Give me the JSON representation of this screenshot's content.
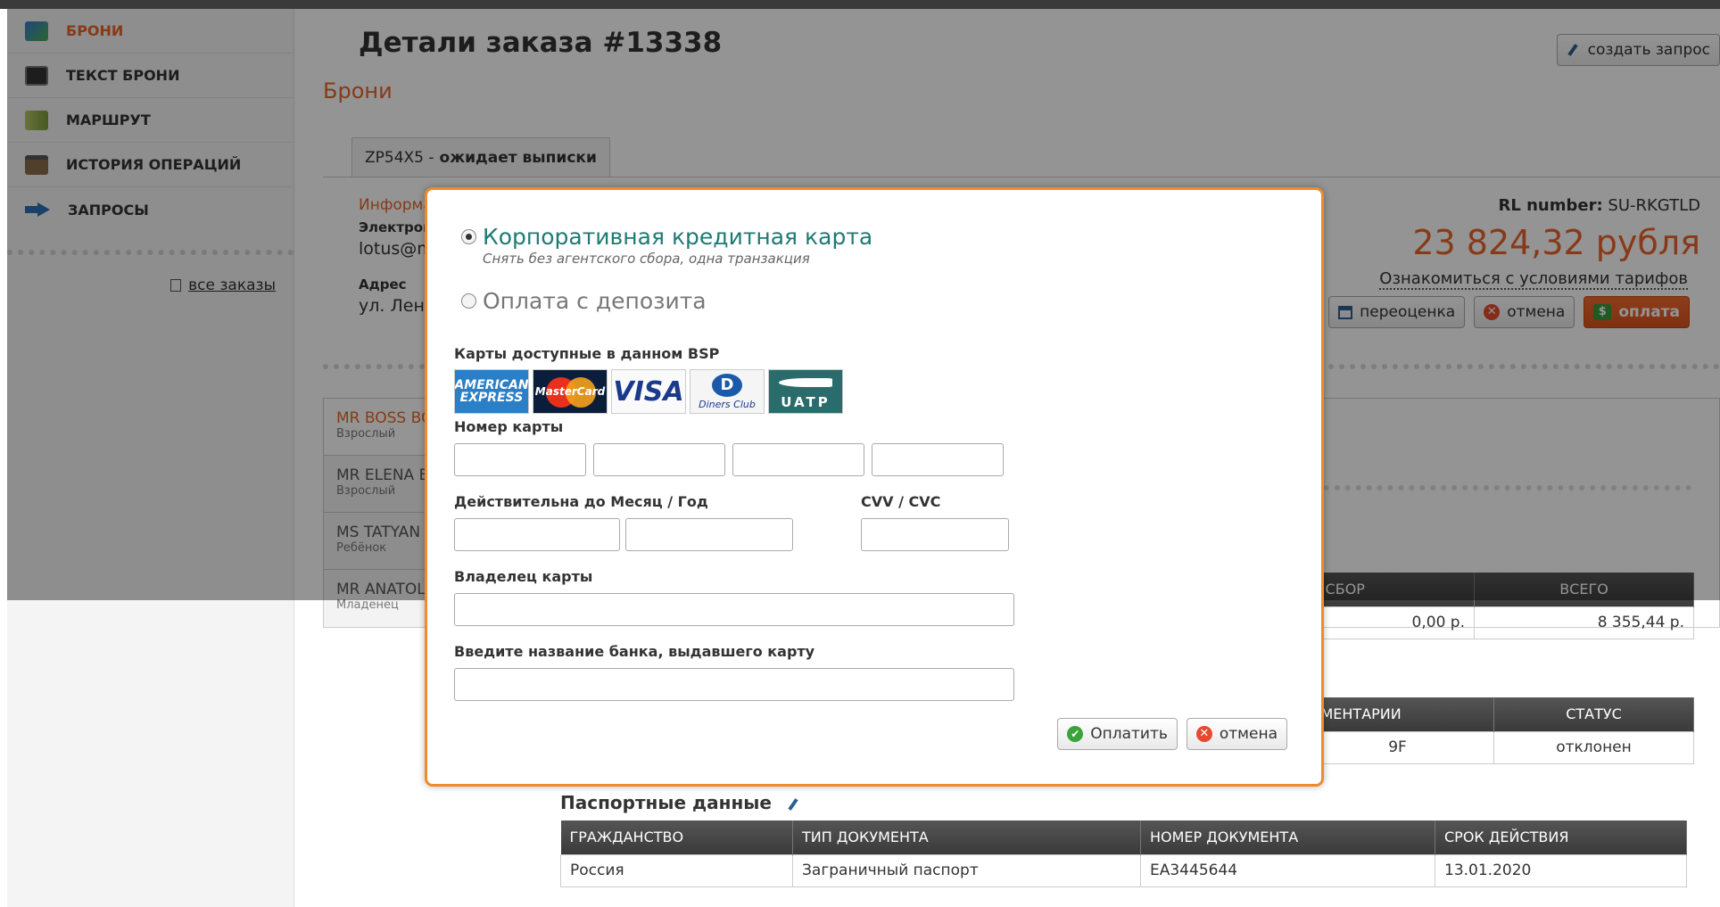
{
  "sidebar": {
    "items": [
      {
        "label": "БРОНИ",
        "icon": "bookings-icon"
      },
      {
        "label": "ТЕКСТ БРОНИ",
        "icon": "terminal-icon"
      },
      {
        "label": "МАРШРУТ",
        "icon": "map-icon"
      },
      {
        "label": "ИСТОРИЯ ОПЕРАЦИЙ",
        "icon": "history-icon"
      },
      {
        "label": "ЗАПРОСЫ",
        "icon": "arrow-right-icon"
      }
    ],
    "all_orders": "все заказы"
  },
  "header": {
    "title": "Детали заказа #13338",
    "create_request": "создать запрос"
  },
  "section_title": "Брони",
  "booking_tab": {
    "pnr": "ZP54X5 -",
    "status": "ожидает выписки"
  },
  "info": {
    "label": "Информа",
    "email_label": "Электрон",
    "email_value": "lotus@m",
    "address_label": "Адрес",
    "address_value": "ул. Лени"
  },
  "summary": {
    "rl_label": "RL number:",
    "rl_value": "SU-RKGTLD",
    "price": "23 824,32 рубля",
    "tariff_link": "Ознакомиться с условиями тарифов",
    "btn_reprice": "переоценка",
    "btn_cancel": "отмена",
    "btn_pay": "оплата"
  },
  "passengers": [
    {
      "name": "MR BOSS BC",
      "type": "Взрослый"
    },
    {
      "name": "MR ELENA B",
      "type": "Взрослый"
    },
    {
      "name": "MS TATYAN",
      "type": "Ребёнок"
    },
    {
      "name": "MR ANATOL",
      "type": "Младенец"
    }
  ],
  "fare_table": {
    "headers": [
      "Й СБОР",
      "ВСЕГО"
    ],
    "row": [
      "0,00 р.",
      "8 355,44 р."
    ]
  },
  "seat_table": {
    "headers": [
      "ИМЕНТАРИИ",
      "СТАТУС"
    ],
    "row": [
      "9F",
      "отклонен"
    ]
  },
  "passport": {
    "title": "Паспортные данные",
    "headers": [
      "ГРАЖДАНСТВО",
      "ТИП ДОКУМЕНТА",
      "НОМЕР ДОКУМЕНТА",
      "СРОК ДЕЙСТВИЯ"
    ],
    "row": [
      "Россия",
      "Заграничный паспорт",
      "EA3445644",
      "13.01.2020"
    ]
  },
  "modal": {
    "option_card": "Корпоративная кредитная карта",
    "option_card_sub": "Снять без агентского сбора, одна транзакция",
    "option_deposit": "Оплата с депозита",
    "cards_label": "Карты доступные в данном BSP",
    "cards": [
      "AMERICAN EXPRESS",
      "MasterCard",
      "VISA",
      "Diners Club",
      "UATP"
    ],
    "card_number_label": "Номер карты",
    "expiry_label": "Действительна до Месяц / Год",
    "cvv_label": "CVV / CVC",
    "holder_label": "Владелец карты",
    "bank_label": "Введите название банка, выдавшего карту",
    "btn_pay": "Оплатить",
    "btn_cancel": "отмена",
    "selected_option": "card"
  },
  "colors": {
    "accent": "#e8642a",
    "modal_border": "#f08a2a",
    "option_active": "#1f7a73"
  }
}
